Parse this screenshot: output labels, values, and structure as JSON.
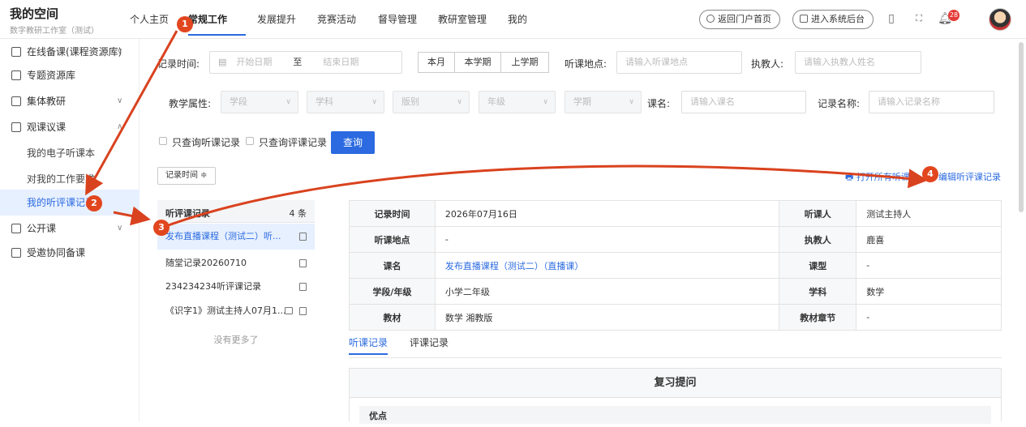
{
  "header": {
    "title": "我的空间",
    "subtitle": "数字教研工作室（测试）",
    "nav": [
      "个人主页",
      "常规工作",
      "发展提升",
      "竞赛活动",
      "督导管理",
      "教研室管理",
      "我的"
    ],
    "back_portal": "返回门户首页",
    "enter_admin": "进入系统后台",
    "notif_count": "28"
  },
  "sidebar": {
    "items": [
      {
        "label": "在线备课(课程资源库)",
        "icon": "doc-icon",
        "expand": "∨"
      },
      {
        "label": "专题资源库",
        "icon": "folder-icon",
        "expand": ""
      },
      {
        "label": "集体教研",
        "icon": "book-icon",
        "expand": "∨"
      },
      {
        "label": "观课议课",
        "icon": "class-icon",
        "expand": "∧"
      },
      {
        "label": "我的电子听课本",
        "sub": true
      },
      {
        "label": "对我的工作要求",
        "sub": true
      },
      {
        "label": "我的听评课记录",
        "sub": true,
        "selected": true
      },
      {
        "label": "公开课",
        "icon": "screen-icon",
        "expand": "∨"
      },
      {
        "label": "受邀协同备课",
        "icon": "team-icon",
        "expand": ""
      }
    ]
  },
  "filters": {
    "record_time_label": "记录时间:",
    "start_placeholder": "开始日期",
    "to": "至",
    "end_placeholder": "结束日期",
    "quick": [
      "本月",
      "本学期",
      "上学期"
    ],
    "location_label": "听课地点:",
    "location_placeholder": "请输入听课地点",
    "teacher_label": "执教人:",
    "teacher_placeholder": "请输入执教人姓名",
    "attr_label": "教学属性:",
    "attrs": [
      "学段",
      "学科",
      "版别",
      "年级",
      "学期"
    ],
    "course_label": "课名:",
    "course_placeholder": "请输入课名",
    "record_name_label": "记录名称:",
    "record_name_placeholder": "请输入记录名称",
    "only_listen": "只查询听课记录",
    "only_review": "只查询评课记录",
    "query": "查询"
  },
  "toolbar": {
    "sort": "记录时间 ≑",
    "print_all": "打开所有听课",
    "edit": "编辑听评课记录"
  },
  "list": {
    "title": "听评课记录",
    "count": "4 条",
    "items": [
      "发布直播课程（测试二）听...",
      "随堂记录20260710",
      "234234234听评课记录",
      "《识字1》测试主持人07月1..."
    ],
    "no_more": "没有更多了"
  },
  "detail": {
    "rows": [
      [
        "记录时间",
        "2026年07月16日",
        "听课人",
        "测试主持人"
      ],
      [
        "听课地点",
        "-",
        "执教人",
        "鹿喜"
      ],
      [
        "课名",
        "发布直播课程（测试二）（直播课）",
        "课型",
        "-"
      ],
      [
        "学段/年级",
        "小学二年级",
        "学科",
        "数学"
      ],
      [
        "教材",
        "数学 湘教版",
        "教材章节",
        "-"
      ]
    ]
  },
  "tabs": [
    "听课记录",
    "评课记录"
  ],
  "review": {
    "heading": "复习提问",
    "sub": "优点"
  },
  "annotations": {
    "steps": [
      "1",
      "2",
      "3",
      "4"
    ],
    "arrow_color": "#d9421e"
  }
}
